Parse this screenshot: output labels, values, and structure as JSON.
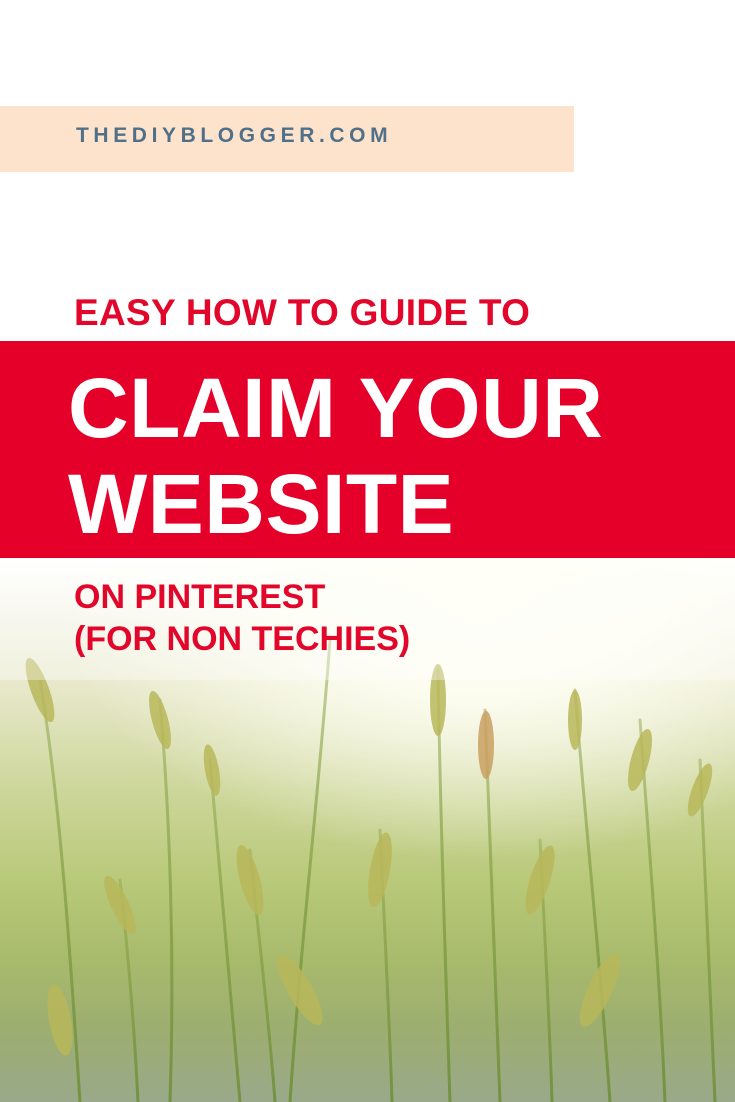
{
  "domain": "THEDIYBLOGGER.COM",
  "kicker": "EASY HOW TO GUIDE TO",
  "headline": {
    "line1": "CLAIM YOUR",
    "line2": "WEBSITE"
  },
  "subtitle": {
    "line1": "ON PINTEREST",
    "line2": "(FOR NON TECHIES)"
  },
  "colors": {
    "brand_red": "#e5002a",
    "band_peach": "#fde3cb",
    "domain_text": "#50708a"
  }
}
